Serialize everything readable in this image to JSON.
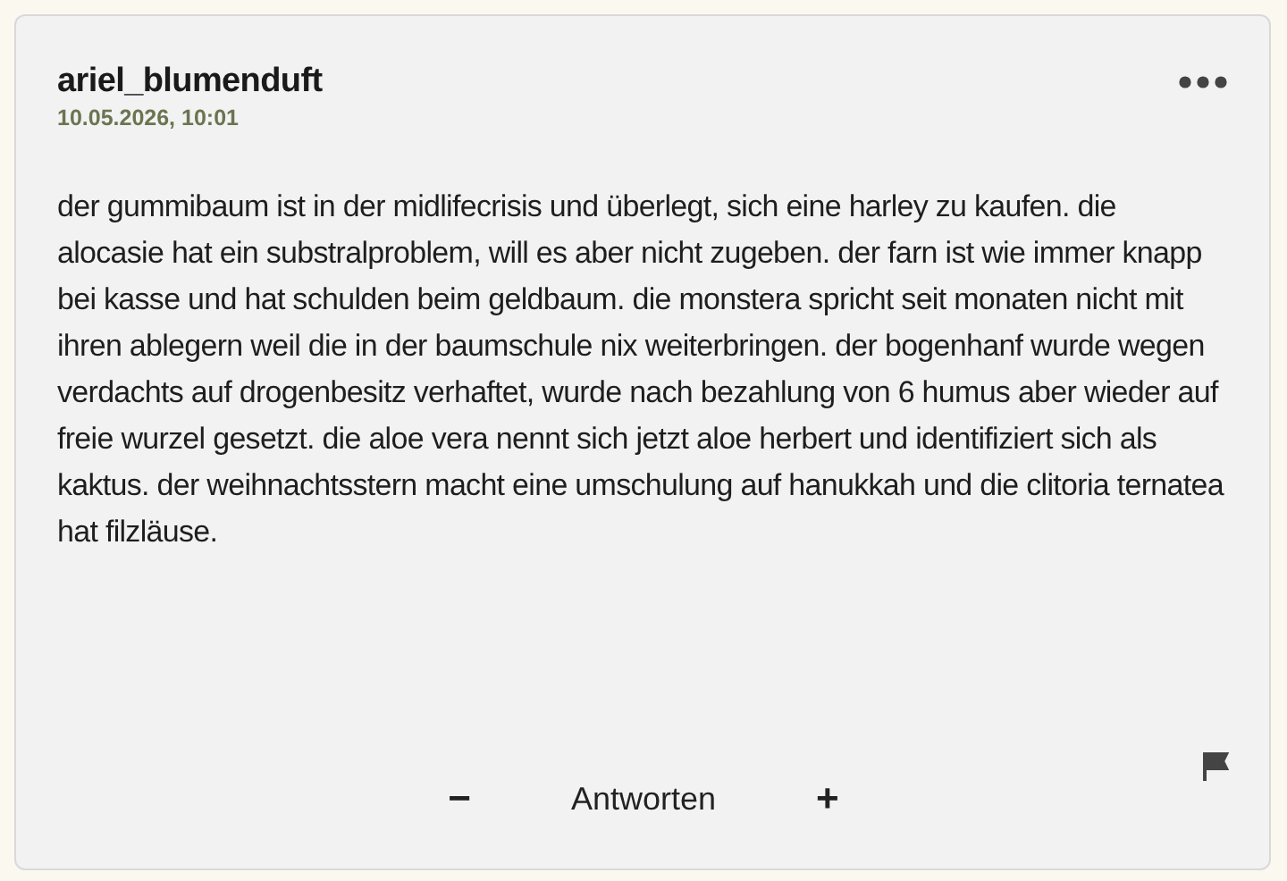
{
  "comment": {
    "author": "ariel_blumenduft",
    "timestamp": "10.05.2026, 10:01",
    "body": "der gummibaum ist in der midlifecrisis und überlegt, sich eine harley zu kaufen. die alocasie hat ein substralproblem, will es aber nicht zugeben. der farn ist wie immer knapp bei kasse und hat schulden beim geldbaum. die monstera spricht seit monaten nicht mit ihren ablegern weil die in der baumschule nix weiterbringen. der bogenhanf wurde wegen verdachts auf drogenbesitz verhaftet, wurde nach bezahlung von 6 humus aber wieder auf freie wurzel gesetzt. die aloe vera nennt sich jetzt aloe herbert und identifiziert sich als kaktus. der weihnachtsstern macht eine umschulung auf hanukkah und die clitoria ternatea hat filzläuse."
  },
  "actions": {
    "collapse": "−",
    "reply": "Antworten",
    "expand": "+"
  }
}
